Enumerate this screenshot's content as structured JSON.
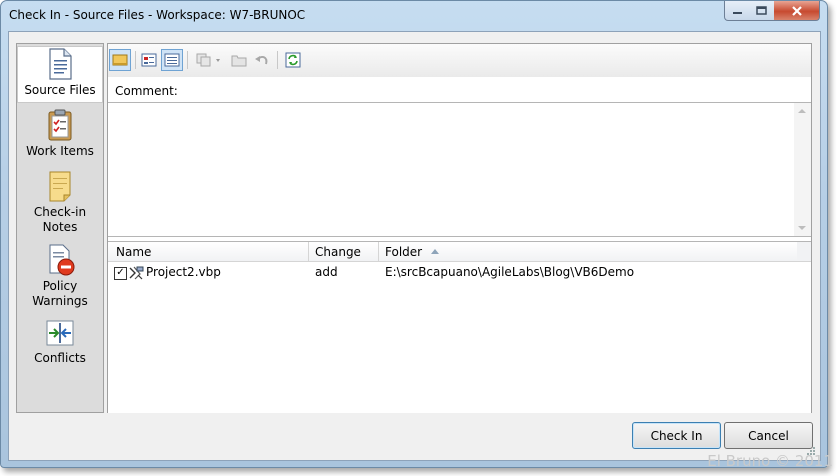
{
  "window": {
    "title": "Check In - Source Files - Workspace: W7-BRUNOC"
  },
  "sidebar": {
    "items": [
      {
        "label": "Source Files",
        "icon": "source-files-icon",
        "selected": true
      },
      {
        "label": "Work Items",
        "icon": "work-items-icon",
        "selected": false
      },
      {
        "label_line1": "Check-in",
        "label_line2": "Notes",
        "icon": "checkin-notes-icon",
        "selected": false
      },
      {
        "label_line1": "Policy",
        "label_line2": "Warnings",
        "icon": "policy-warnings-icon",
        "selected": false
      },
      {
        "label": "Conflicts",
        "icon": "conflicts-icon",
        "selected": false
      }
    ]
  },
  "comment": {
    "label": "Comment:",
    "value": ""
  },
  "files_table": {
    "columns": [
      "Name",
      "Change",
      "Folder"
    ],
    "sorted_column": "Folder",
    "rows": [
      {
        "checked": true,
        "name": "Project2.vbp",
        "change": "add",
        "folder": "E:\\srcBcapuano\\AgileLabs\\Blog\\VB6Demo"
      }
    ]
  },
  "buttons": {
    "check_in": "Check In",
    "cancel": "Cancel"
  },
  "watermark": "El Bruno © 2011",
  "colors": {
    "titlebar": "#c6ddf1",
    "close_button": "#c74a30",
    "selected_tool": "#cfe3f6"
  }
}
